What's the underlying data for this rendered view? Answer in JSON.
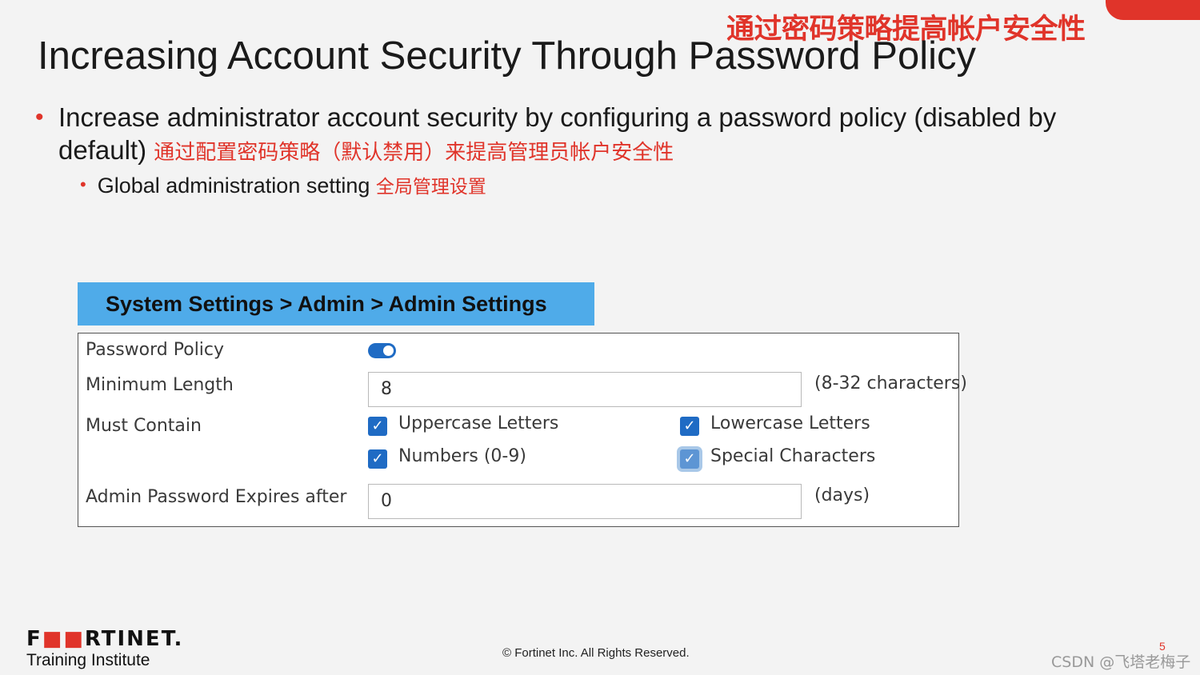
{
  "slide": {
    "title_cn": "通过密码策略提高帐户安全性",
    "title": "Increasing Account Security Through Password Policy",
    "bullet1_text": "Increase administrator account security by configuring a password policy (disabled by default)",
    "bullet1_cn": "通过配置密码策略（默认禁用）来提高管理员帐户安全性",
    "bullet2_text": "Global administration setting",
    "bullet2_cn": "全局管理设置",
    "bullet_glyph": "•",
    "accent_color": "#e0342a"
  },
  "breadcrumb": "System Settings > Admin > Admin Settings",
  "form": {
    "password_policy_label": "Password Policy",
    "password_policy_enabled": true,
    "min_length_label": "Minimum Length",
    "min_length_value": "8",
    "min_length_hint": "(8-32 characters)",
    "must_contain_label": "Must Contain",
    "checkboxes": [
      {
        "label": "Uppercase Letters",
        "checked": true,
        "mark": "✓"
      },
      {
        "label": "Lowercase Letters",
        "checked": true,
        "mark": "✓"
      },
      {
        "label": "Numbers (0-9)",
        "checked": true,
        "mark": "✓"
      },
      {
        "label": "Special Characters",
        "checked": true,
        "mark": "✓"
      }
    ],
    "expires_label": "Admin Password Expires after",
    "expires_value": "0",
    "expires_hint": "(days)",
    "toggle_color": "#1f6bc4"
  },
  "footer": {
    "logo_parts": [
      "F",
      "■■",
      "RTINET",
      "."
    ],
    "training": "Training Institute",
    "copyright": "© Fortinet Inc. All Rights Reserved.",
    "page_number": "5",
    "watermark": "CSDN @飞塔老梅子"
  }
}
